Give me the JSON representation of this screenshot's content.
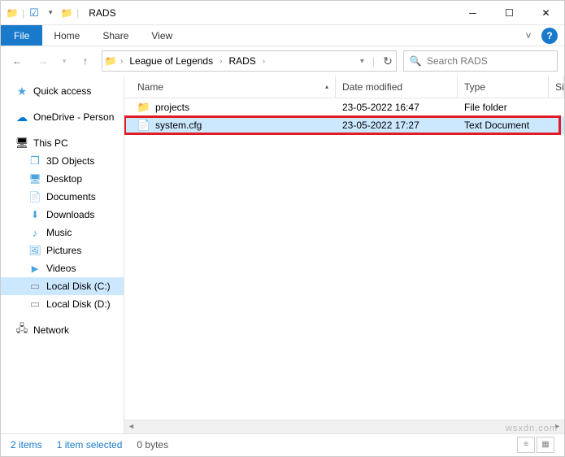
{
  "window": {
    "title": "RADS"
  },
  "ribbon": {
    "file": "File",
    "tabs": [
      "Home",
      "Share",
      "View"
    ]
  },
  "breadcrumb": {
    "segments": [
      "League of Legends",
      "RADS"
    ]
  },
  "search": {
    "placeholder": "Search RADS"
  },
  "nav": {
    "quick_access": "Quick access",
    "onedrive": "OneDrive - Person",
    "this_pc": "This PC",
    "items": [
      "3D Objects",
      "Desktop",
      "Documents",
      "Downloads",
      "Music",
      "Pictures",
      "Videos",
      "Local Disk (C:)",
      "Local Disk (D:)"
    ],
    "network": "Network"
  },
  "columns": {
    "name": "Name",
    "date": "Date modified",
    "type": "Type",
    "size": "Si"
  },
  "files": [
    {
      "name": "projects",
      "date": "23-05-2022 16:47",
      "type": "File folder",
      "icon": "folder"
    },
    {
      "name": "system.cfg",
      "date": "23-05-2022 17:27",
      "type": "Text Document",
      "icon": "file",
      "selected": true
    }
  ],
  "status": {
    "count": "2 items",
    "selected": "1 item selected",
    "size": "0 bytes"
  },
  "watermark": "wsxdn.com"
}
